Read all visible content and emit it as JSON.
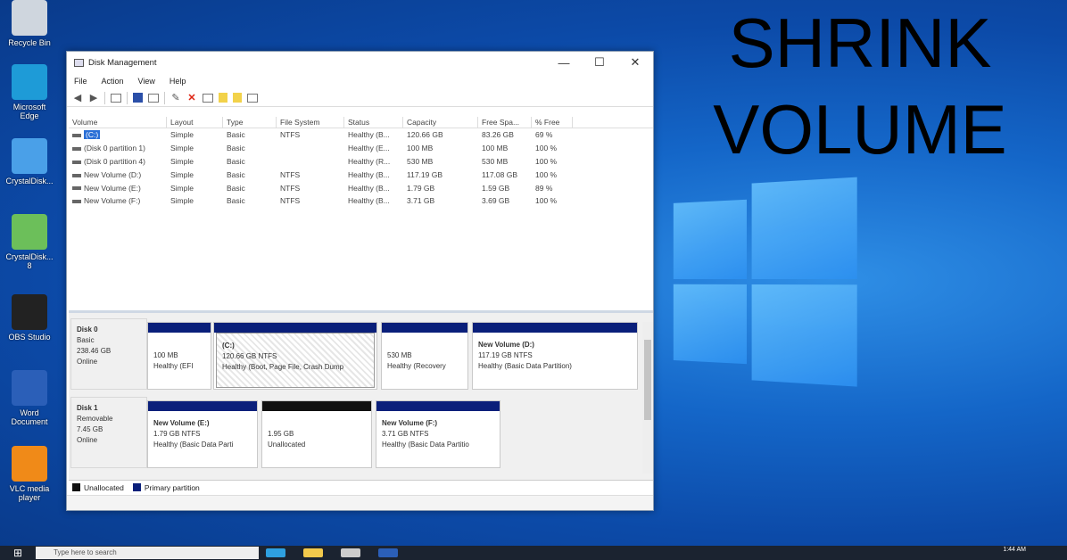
{
  "headline": {
    "line1": "SHRINK",
    "line2": "VOLUME"
  },
  "desktop_icons": [
    {
      "label": "Recycle Bin",
      "icon": "recycle-bin-icon",
      "color": "#cfd6de"
    },
    {
      "label": "Microsoft Edge",
      "icon": "edge-icon",
      "color": "#1e9bd7"
    },
    {
      "label": "CrystalDisk...",
      "icon": "crystaldisk-icon",
      "color": "#4aa0e8"
    },
    {
      "label": "CrystalDisk... 8",
      "icon": "crystaldisk-icon",
      "color": "#6cbf5a"
    },
    {
      "label": "OBS Studio",
      "icon": "obs-icon",
      "color": "#222222"
    },
    {
      "label": "Word Document",
      "icon": "word-icon",
      "color": "#2b5fb8"
    },
    {
      "label": "VLC media player",
      "icon": "vlc-icon",
      "color": "#f08a18"
    }
  ],
  "window": {
    "title": "Disk Management",
    "controls": {
      "minimize": "—",
      "maximize": "☐",
      "close": "✕"
    },
    "menu": [
      "File",
      "Action",
      "View",
      "Help"
    ]
  },
  "volume_table": {
    "columns": [
      "Volume",
      "Layout",
      "Type",
      "File System",
      "Status",
      "Capacity",
      "Free Spa...",
      "% Free"
    ],
    "rows": [
      {
        "volume": "(C:)",
        "layout": "Simple",
        "type": "Basic",
        "fs": "NTFS",
        "status": "Healthy (B...",
        "capacity": "120.66 GB",
        "free": "83.26 GB",
        "pct": "69 %",
        "selected": true
      },
      {
        "volume": "(Disk 0 partition 1)",
        "layout": "Simple",
        "type": "Basic",
        "fs": "",
        "status": "Healthy (E...",
        "capacity": "100 MB",
        "free": "100 MB",
        "pct": "100 %"
      },
      {
        "volume": "(Disk 0 partition 4)",
        "layout": "Simple",
        "type": "Basic",
        "fs": "",
        "status": "Healthy (R...",
        "capacity": "530 MB",
        "free": "530 MB",
        "pct": "100 %"
      },
      {
        "volume": "New Volume (D:)",
        "layout": "Simple",
        "type": "Basic",
        "fs": "NTFS",
        "status": "Healthy (B...",
        "capacity": "117.19 GB",
        "free": "117.08 GB",
        "pct": "100 %"
      },
      {
        "volume": "New Volume (E:)",
        "layout": "Simple",
        "type": "Basic",
        "fs": "NTFS",
        "status": "Healthy (B...",
        "capacity": "1.79 GB",
        "free": "1.59 GB",
        "pct": "89 %"
      },
      {
        "volume": "New Volume (F:)",
        "layout": "Simple",
        "type": "Basic",
        "fs": "NTFS",
        "status": "Healthy (B...",
        "capacity": "3.71 GB",
        "free": "3.69 GB",
        "pct": "100 %"
      }
    ]
  },
  "disks": [
    {
      "name": "Disk 0",
      "kind": "Basic",
      "size": "238.46 GB",
      "state": "Online",
      "partitions": [
        {
          "title": "",
          "line1": "100 MB",
          "line2": "Healthy (EFI",
          "bar": "primary"
        },
        {
          "title": "(C:)",
          "line1": "120.66 GB NTFS",
          "line2": "Healthy (Boot, Page File, Crash Dump",
          "bar": "primary",
          "hatched": true
        },
        {
          "title": "",
          "line1": "530 MB",
          "line2": "Healthy (Recovery",
          "bar": "primary"
        },
        {
          "title": "New Volume (D:)",
          "line1": "117.19 GB NTFS",
          "line2": "Healthy (Basic Data Partition)",
          "bar": "primary"
        }
      ]
    },
    {
      "name": "Disk 1",
      "kind": "Removable",
      "size": "7.45 GB",
      "state": "Online",
      "partitions": [
        {
          "title": "New Volume (E:)",
          "line1": "1.79 GB NTFS",
          "line2": "Healthy (Basic Data Parti",
          "bar": "primary"
        },
        {
          "title": "",
          "line1": "1.95 GB",
          "line2": "Unallocated",
          "bar": "unallocated"
        },
        {
          "title": "New Volume (F:)",
          "line1": "3.71 GB NTFS",
          "line2": "Healthy (Basic Data Partitio",
          "bar": "primary"
        }
      ]
    }
  ],
  "legend": [
    {
      "label": "Unallocated",
      "color": "#111111"
    },
    {
      "label": "Primary partition",
      "color": "#0a1f7a"
    }
  ],
  "taskbar": {
    "search_placeholder": "Type here to search",
    "clock": "1:44 AM"
  }
}
